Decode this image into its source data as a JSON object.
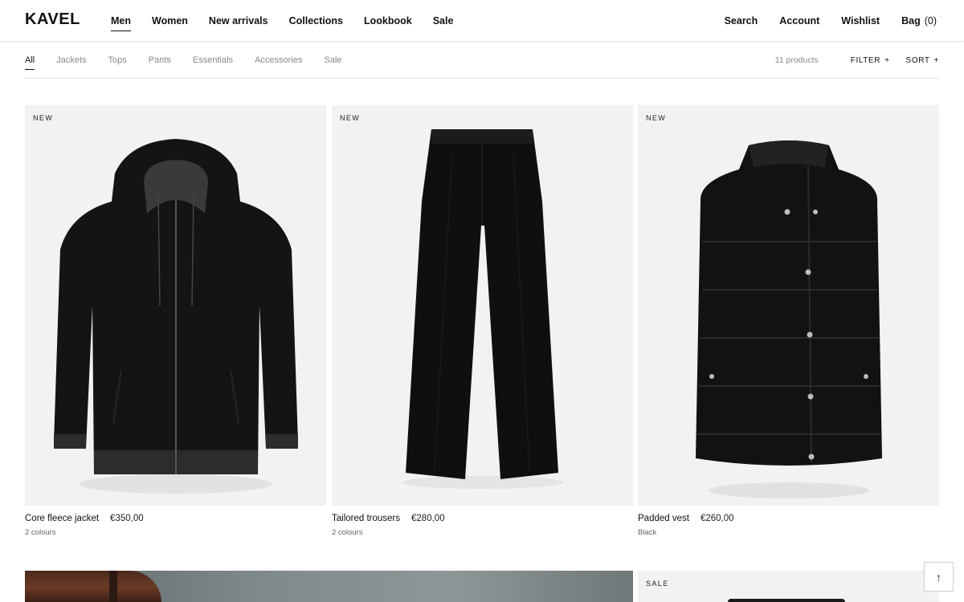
{
  "brand": {
    "logo": "KAVEL"
  },
  "main_nav": {
    "items": [
      {
        "label": "Men",
        "active": true
      },
      {
        "label": "Women"
      },
      {
        "label": "New arrivals"
      },
      {
        "label": "Collections"
      },
      {
        "label": "Lookbook"
      },
      {
        "label": "Sale"
      }
    ]
  },
  "utility_nav": {
    "search": "Search",
    "account": "Account",
    "wishlist": "Wishlist",
    "bag": "Bag",
    "bag_count": "(0)"
  },
  "categories": {
    "items": [
      {
        "label": "All",
        "active": true
      },
      {
        "label": "Jackets"
      },
      {
        "label": "Tops"
      },
      {
        "label": "Pants"
      },
      {
        "label": "Essentials"
      },
      {
        "label": "Accessories"
      },
      {
        "label": "Sale"
      }
    ]
  },
  "toolbar": {
    "product_count": "11 products",
    "filter_label": "FILTER",
    "sort_label": "SORT",
    "plus": "+"
  },
  "products": [
    {
      "badge": "NEW",
      "name": "Core fleece jacket",
      "price": "€350,00",
      "sub": "2 colours",
      "image_icon": "hooded-fleece-jacket"
    },
    {
      "badge": "NEW",
      "name": "Tailored trousers",
      "price": "€280,00",
      "sub": "2 colours",
      "image_icon": "wide-leg-trousers"
    },
    {
      "badge": "NEW",
      "name": "Padded vest",
      "price": "€260,00",
      "sub": "Black",
      "image_icon": "padded-vest"
    }
  ],
  "bottom_row": {
    "sale_badge": "SALE"
  },
  "back_to_top": {
    "icon": "arrow-up-icon",
    "glyph": "↑"
  },
  "colors": {
    "accent": "#111111",
    "image_bg": "#f2f2f1",
    "muted": "#888888"
  }
}
